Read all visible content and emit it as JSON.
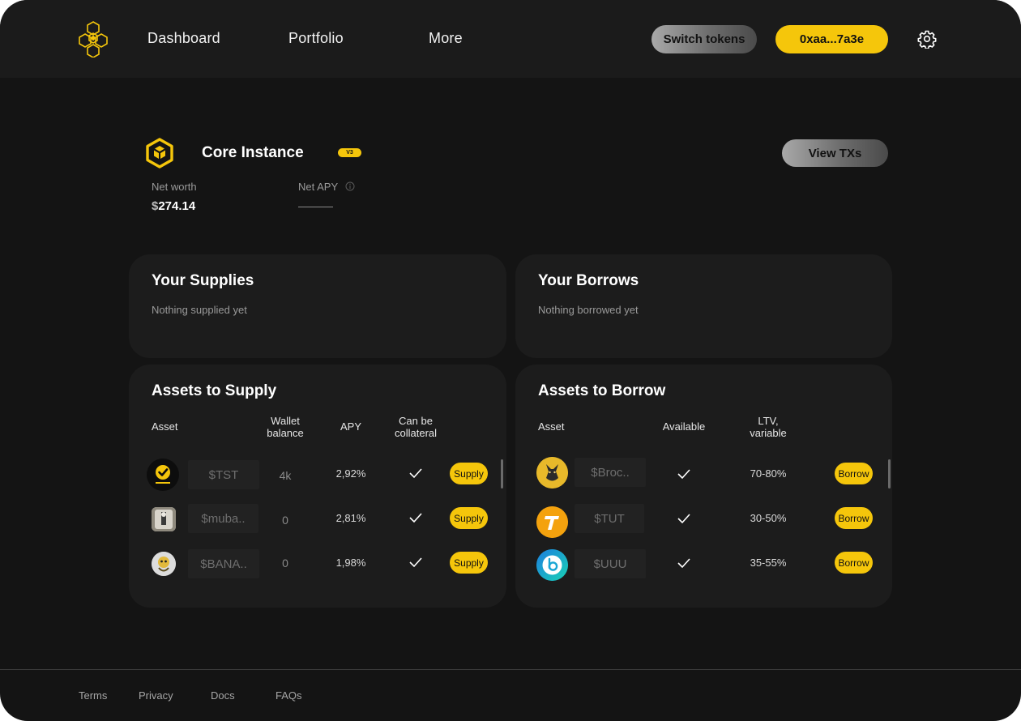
{
  "nav": {
    "items": [
      "Dashboard",
      "Portfolio",
      "More"
    ],
    "switch_tokens": "Switch tokens",
    "wallet": "0xaa...7a3e"
  },
  "instance": {
    "title": "Core Instance",
    "badge": "V3",
    "view_txs": "View TXs",
    "net_worth_label": "Net worth",
    "net_worth_currency": "$",
    "net_worth_value": "274.14",
    "net_apy_label": "Net APY"
  },
  "supplies": {
    "title": "Your Supplies",
    "empty": "Nothing supplied yet"
  },
  "borrows": {
    "title": "Your Borrows",
    "empty": "Nothing borrowed yet"
  },
  "assets_supply": {
    "title": "Assets to Supply",
    "columns": [
      "Asset",
      "Wallet\nbalance",
      "APY",
      "Can be\ncollateral"
    ],
    "rows": [
      {
        "symbol": "$TST",
        "balance": "4k",
        "apy": "2,92%",
        "collateral": true,
        "action": "Supply",
        "icon": "test-token-icon"
      },
      {
        "symbol": "$muba..",
        "balance": "0",
        "apy": "2,81%",
        "collateral": true,
        "action": "Supply",
        "icon": "mubarak-token-icon"
      },
      {
        "symbol": "$BANA..",
        "balance": "0",
        "apy": "1,98%",
        "collateral": true,
        "action": "Supply",
        "icon": "banana-token-icon"
      }
    ]
  },
  "assets_borrow": {
    "title": "Assets to Borrow",
    "columns": [
      "Asset",
      "Available",
      "LTV,\nvariable"
    ],
    "rows": [
      {
        "symbol": "$Broc..",
        "available": true,
        "ltv": "70-80%",
        "action": "Borrow",
        "icon": "broccoli-token-icon"
      },
      {
        "symbol": "$TUT",
        "available": true,
        "ltv": "30-50%",
        "action": "Borrow",
        "icon": "tut-token-icon"
      },
      {
        "symbol": "$UUU",
        "available": true,
        "ltv": "35-55%",
        "action": "Borrow",
        "icon": "uuu-token-icon"
      }
    ]
  },
  "footer": {
    "links": [
      "Terms",
      "Privacy",
      "Docs",
      "FAQs"
    ]
  },
  "colors": {
    "accent": "#f5c60b",
    "background": "#141414",
    "card": "#1c1c1c"
  }
}
